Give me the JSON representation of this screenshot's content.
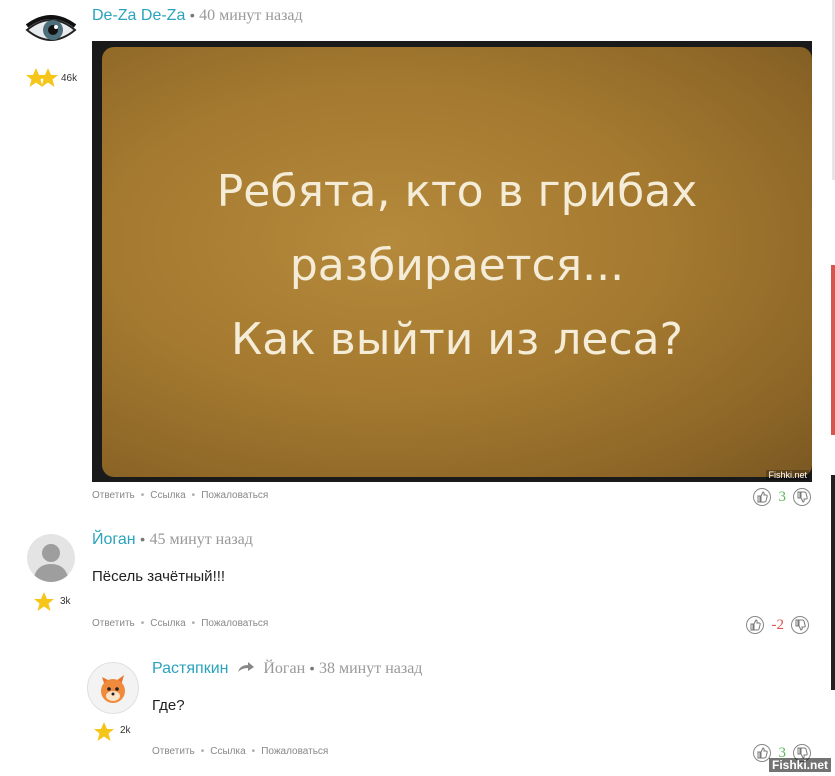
{
  "comments": [
    {
      "author": "De-Za De-Za",
      "time": "40 минут назад",
      "karma": "46k",
      "meme_lines": [
        "Ребята, кто в грибах",
        "разбирается...",
        "Как выйти из леса?"
      ],
      "watermark": "Fishki.net",
      "actions": [
        "Ответить",
        "Ссылка",
        "Пожаловаться"
      ],
      "score": "3",
      "score_color": "#5cb85c"
    },
    {
      "author": "Йоган",
      "time": "45 минут назад",
      "karma": "3k",
      "text": "Пёсель зачётный!!!",
      "actions": [
        "Ответить",
        "Ссылка",
        "Пожаловаться"
      ],
      "score": "-2",
      "score_color": "#d9534f"
    },
    {
      "author": "Растяпкин",
      "reply_to": "Йоган",
      "time": "38 минут назад",
      "karma": "2k",
      "text": "Где?",
      "actions": [
        "Ответить",
        "Ссылка",
        "Пожаловаться"
      ],
      "score": "3",
      "score_color": "#5cb85c"
    }
  ],
  "site_watermark": "Fishki.net",
  "colors": {
    "link": "#2aa3bd",
    "accent_bar": "#d9534f"
  }
}
